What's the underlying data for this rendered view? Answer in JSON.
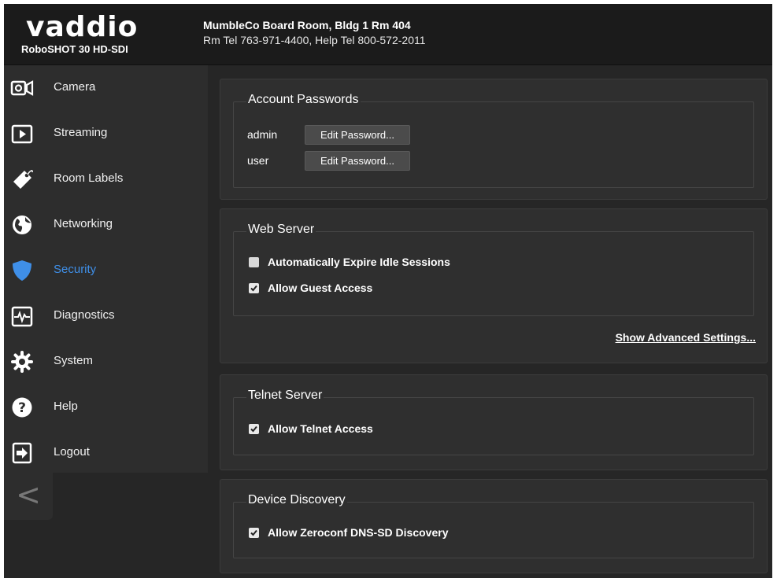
{
  "header": {
    "brand": "vaddio",
    "model": "RoboSHOT 30 HD-SDI",
    "room_title": "MumbleCo Board Room, Bldg 1 Rm 404",
    "room_tel": "Rm Tel 763-971-4400, Help Tel 800-572-2011"
  },
  "sidebar": {
    "items": [
      {
        "label": "Camera",
        "icon": "camera-icon"
      },
      {
        "label": "Streaming",
        "icon": "play-icon"
      },
      {
        "label": "Room Labels",
        "icon": "tag-icon"
      },
      {
        "label": "Networking",
        "icon": "globe-icon"
      },
      {
        "label": "Security",
        "icon": "shield-icon",
        "active": true
      },
      {
        "label": "Diagnostics",
        "icon": "pulse-icon"
      },
      {
        "label": "System",
        "icon": "gear-icon"
      },
      {
        "label": "Help",
        "icon": "help-icon"
      },
      {
        "label": "Logout",
        "icon": "logout-icon"
      }
    ],
    "collapse_glyph": "<"
  },
  "account_passwords": {
    "legend": "Account Passwords",
    "rows": [
      {
        "user": "admin",
        "button": "Edit Password..."
      },
      {
        "user": "user",
        "button": "Edit Password..."
      }
    ]
  },
  "web_server": {
    "legend": "Web Server",
    "options": [
      {
        "label": "Automatically Expire Idle Sessions",
        "checked": false
      },
      {
        "label": "Allow Guest Access",
        "checked": true
      }
    ],
    "advanced_link": "Show Advanced Settings..."
  },
  "telnet_server": {
    "legend": "Telnet Server",
    "options": [
      {
        "label": "Allow Telnet Access",
        "checked": true
      }
    ]
  },
  "device_discovery": {
    "legend": "Device Discovery",
    "options": [
      {
        "label": "Allow Zeroconf DNS-SD Discovery",
        "checked": true
      }
    ]
  },
  "colors": {
    "accent": "#3f8fe8",
    "background": "#262626",
    "panel": "#2f2f2f",
    "topbar": "#1b1b1b"
  }
}
